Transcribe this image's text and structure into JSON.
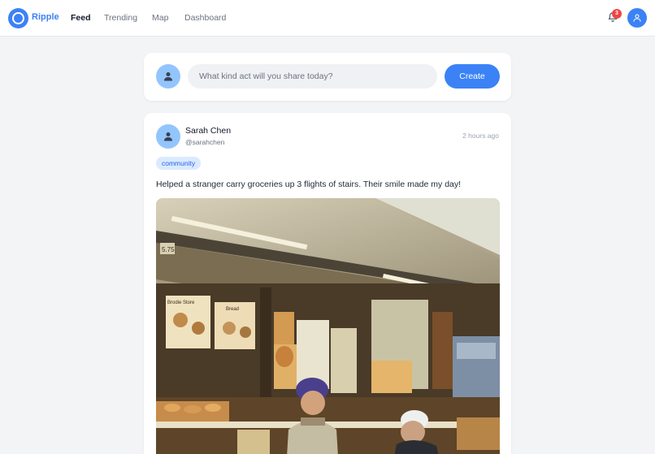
{
  "app": {
    "brand": "Ripple",
    "accent_color": "#3b82f6"
  },
  "nav": {
    "items": [
      {
        "label": "Feed",
        "active": true
      },
      {
        "label": "Trending",
        "active": false
      },
      {
        "label": "Map",
        "active": false
      },
      {
        "label": "Dashboard",
        "active": false
      }
    ]
  },
  "notifications": {
    "icon": "bell-icon",
    "count": "3"
  },
  "user_menu": {
    "icon": "user-icon"
  },
  "compose": {
    "placeholder": "What kind act will you share today?",
    "button_label": "Create"
  },
  "post": {
    "author_name": "Sarah Chen",
    "author_handle": "@sarahchen",
    "timestamp": "2 hours ago",
    "tag": "community",
    "text": "Helped a stranger carry groceries up 3 flights of stairs. Their smile made my day!",
    "image_sign_1": "Brodie Store",
    "image_sign_2": "Bread",
    "image_price": "5.75"
  }
}
